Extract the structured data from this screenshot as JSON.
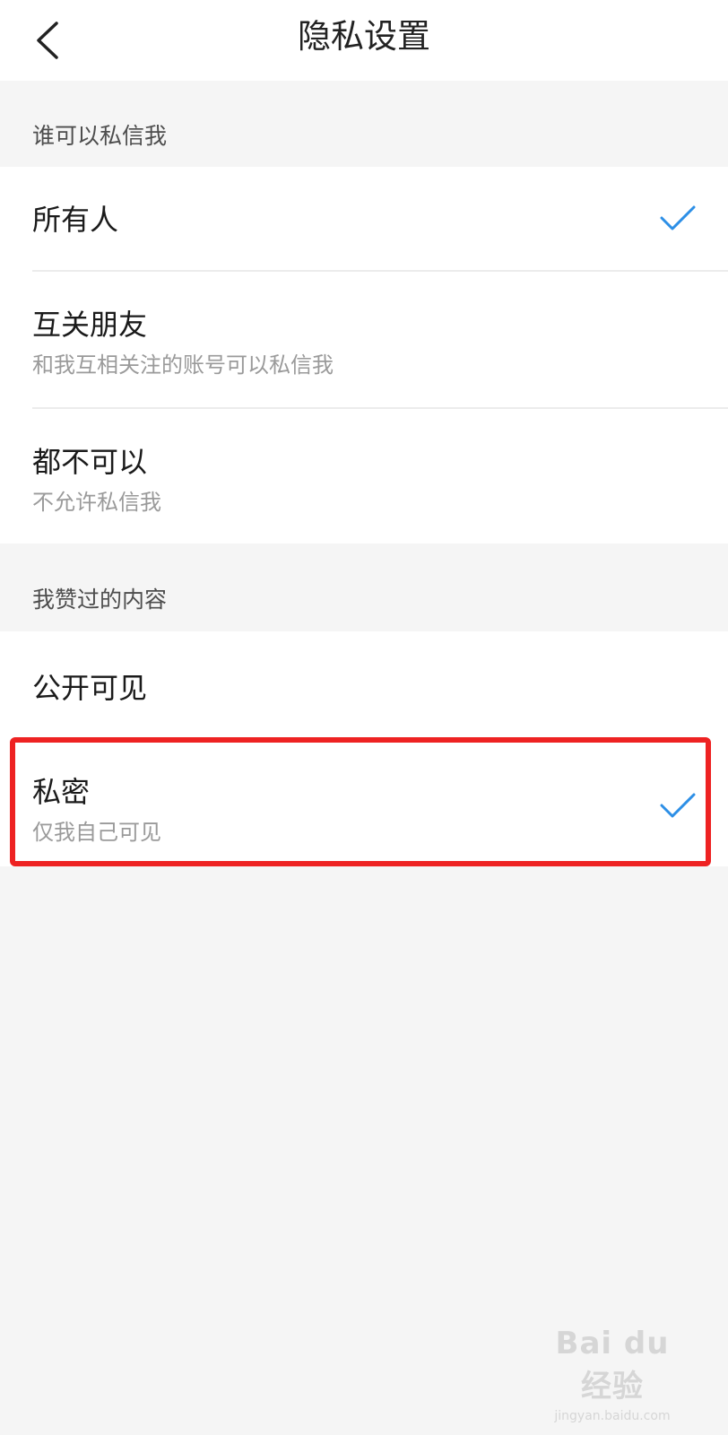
{
  "header": {
    "title": "隐私设置",
    "back_icon": "chevron-left-icon"
  },
  "sections": [
    {
      "label": "谁可以私信我",
      "options": [
        {
          "title": "所有人",
          "subtitle": "",
          "selected": true
        },
        {
          "title": "互关朋友",
          "subtitle": "和我互相关注的账号可以私信我",
          "selected": false
        },
        {
          "title": "都不可以",
          "subtitle": "不允许私信我",
          "selected": false
        }
      ]
    },
    {
      "label": "我赞过的内容",
      "options": [
        {
          "title": "公开可见",
          "subtitle": "",
          "selected": false
        },
        {
          "title": "私密",
          "subtitle": "仅我自己可见",
          "selected": true
        }
      ]
    }
  ],
  "colors": {
    "accent_check": "#2d8fe6",
    "highlight_border": "#ee2222",
    "background": "#f5f5f5"
  },
  "watermark": {
    "logo": "Bai du 经验",
    "url": "jingyan.baidu.com"
  }
}
